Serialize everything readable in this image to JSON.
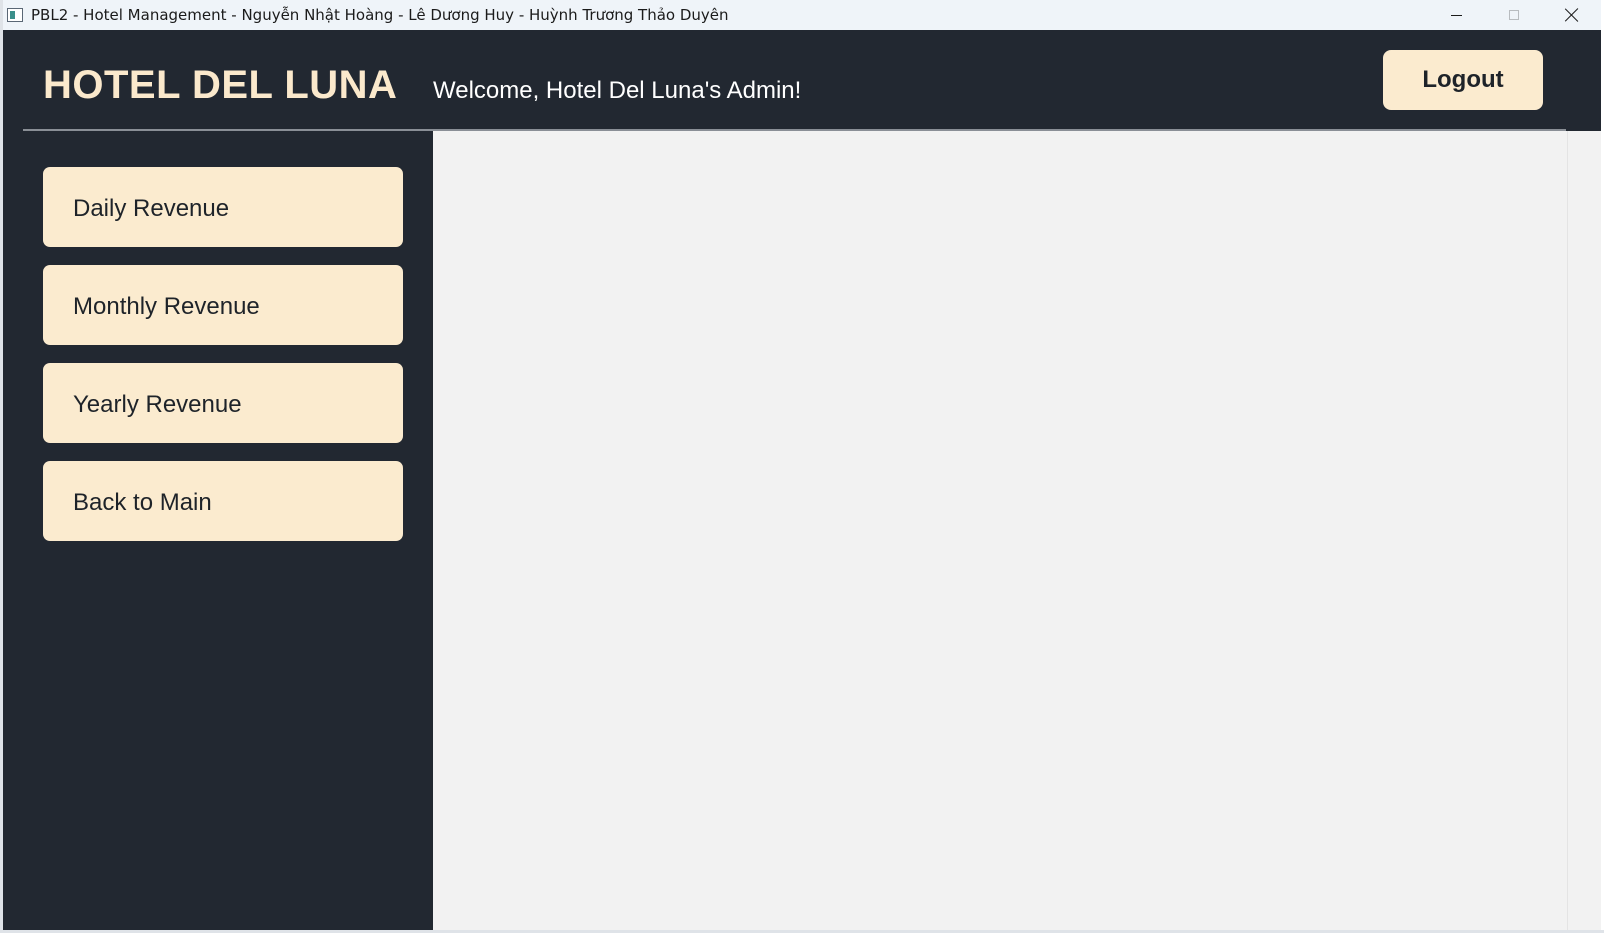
{
  "window": {
    "title": "PBL2 - Hotel Management - Nguyễn Nhật Hoàng - Lê Dương Huy - Huỳnh Trương Thảo Duyên",
    "controls": {
      "minimize_icon": "minimize-icon",
      "maximize_icon": "maximize-icon",
      "close_icon": "close-icon"
    }
  },
  "header": {
    "brand": "HOTEL DEL LUNA",
    "welcome": "Welcome, Hotel Del Luna's Admin!",
    "logout_label": "Logout"
  },
  "sidebar": {
    "items": [
      {
        "label": "Daily Revenue"
      },
      {
        "label": "Monthly Revenue"
      },
      {
        "label": "Yearly Revenue"
      },
      {
        "label": "Back to Main"
      }
    ]
  },
  "colors": {
    "background_dark": "#222831",
    "accent_cream": "#fbebcf",
    "brand_text": "#fbe9cc",
    "content_bg": "#f2f2f2"
  }
}
